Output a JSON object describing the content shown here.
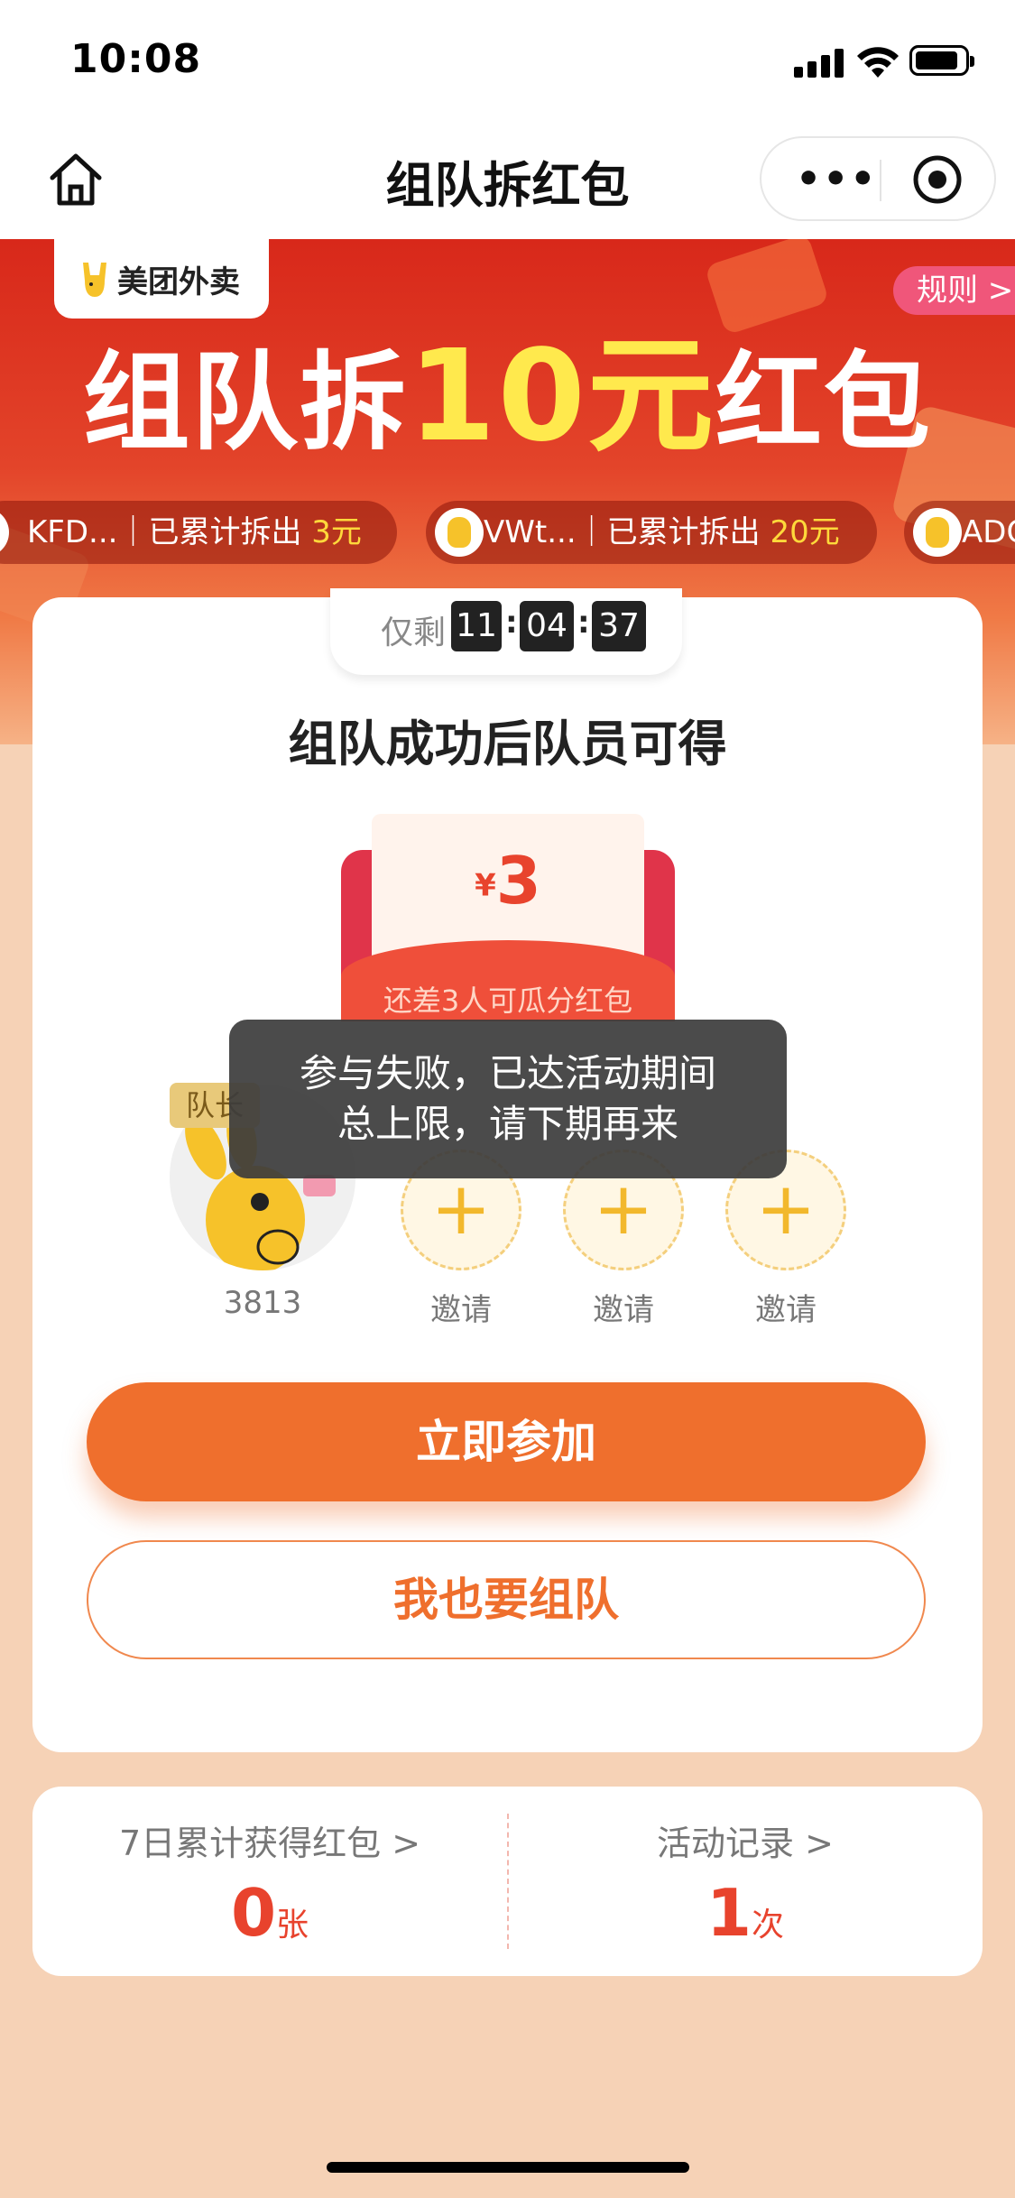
{
  "status_bar": {
    "time": "10:08"
  },
  "nav": {
    "title": "组队拆红包"
  },
  "banner": {
    "brand": "美团外卖",
    "rules": "规则 >",
    "hero_pre": "组队拆",
    "hero_num": "10元",
    "hero_post": "红包",
    "tickers": [
      {
        "name": "KFD...",
        "sep": "｜已累计拆出 ",
        "amount": "3元"
      },
      {
        "name": "VWt...",
        "sep": "｜已累计拆出 ",
        "amount": "20元"
      },
      {
        "name": "ADC",
        "sep": "",
        "amount": ""
      }
    ]
  },
  "card": {
    "timer_label": "仅剩",
    "timer": [
      "11",
      "04",
      "37"
    ],
    "headline": "组队成功后队员可得",
    "envelope": {
      "currency": "¥",
      "amount": "3",
      "subtitle": "还差3人可瓜分红包"
    },
    "leader": {
      "badge": "队长",
      "name": "3813"
    },
    "slots": [
      "邀请",
      "邀请",
      "邀请"
    ],
    "join_button": "立即参加",
    "team_button": "我也要组队"
  },
  "stats": {
    "left": {
      "label": "7日累计获得红包 >",
      "value": "0",
      "unit": "张"
    },
    "right": {
      "label": "活动记录 >",
      "value": "1",
      "unit": "次"
    }
  },
  "toast": {
    "line1": "参与失败，已达活动期间",
    "line2": "总上限，请下期再来"
  },
  "colors": {
    "primary": "#ef6f2d",
    "accent_red": "#e8432d",
    "banner_red": "#d8281a",
    "gold": "#ffe94d"
  }
}
